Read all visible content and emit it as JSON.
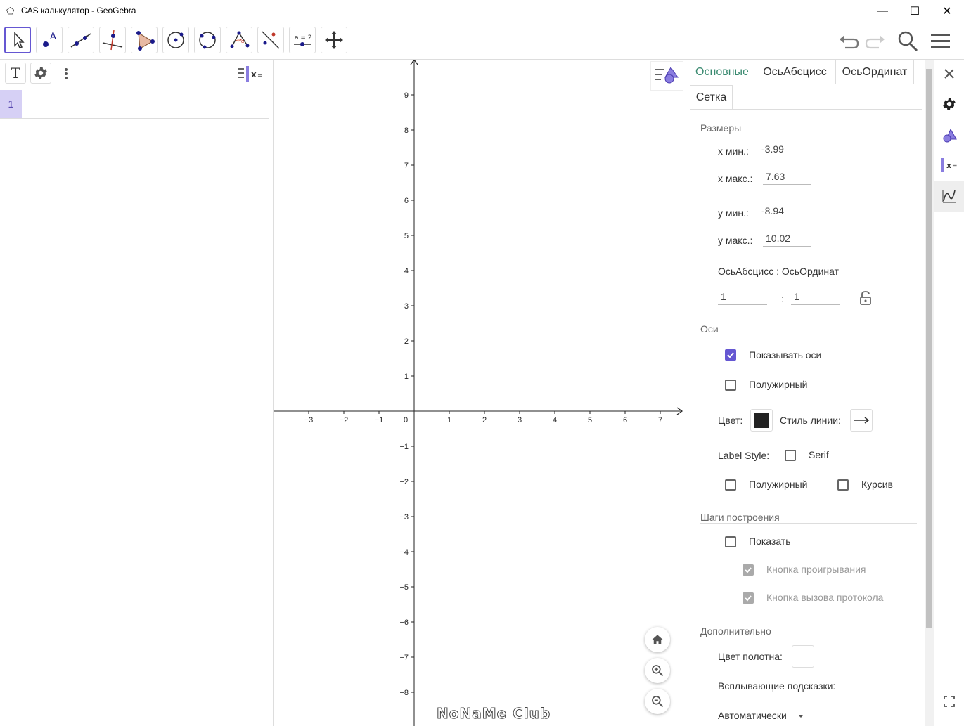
{
  "window": {
    "title": "CAS калькулятор - GeoGebra",
    "minimize": "—",
    "maximize": "☐",
    "close": "✕"
  },
  "toolbar": {
    "tools": [
      "move-tool",
      "point-tool",
      "line-tool",
      "perpendicular-line-tool",
      "polygon-tool",
      "circle-center-point-tool",
      "circle-three-points-tool",
      "angle-tool",
      "reflect-tool",
      "slider-tool",
      "move-graphics-tool"
    ],
    "slider_label": "a = 2"
  },
  "algebra": {
    "text_button": "T",
    "row_number": "1"
  },
  "graphics": {
    "x_ticks": [
      "−3",
      "−2",
      "−1",
      "0",
      "1",
      "2",
      "3",
      "4",
      "5",
      "6",
      "7"
    ],
    "y_ticks_pos": [
      "9",
      "8",
      "7",
      "6",
      "5",
      "4",
      "3",
      "2",
      "1"
    ],
    "y_ticks_neg": [
      "−1",
      "−2",
      "−3",
      "−4",
      "−5",
      "−6",
      "−7",
      "−8"
    ],
    "watermark": "NoNaMe Club"
  },
  "properties": {
    "tabs": [
      "Основные",
      "ОсьАбсцисс",
      "ОсьОрдинат",
      "Сетка"
    ],
    "dimensions": {
      "title": "Размеры",
      "xmin_label": "x мин.:",
      "xmin": "-3.99",
      "xmax_label": "x макс.:",
      "xmax": "7.63",
      "ymin_label": "y мин.:",
      "ymin": "-8.94",
      "ymax_label": "y макс.:",
      "ymax": "10.02",
      "ratio_label": "ОсьАбсцисс : ОсьОрдинат",
      "ratio_x": "1",
      "ratio_sep": ":",
      "ratio_y": "1"
    },
    "axes": {
      "title": "Оси",
      "show_axes": "Показывать оси",
      "bold": "Полужирный",
      "color_label": "Цвет:",
      "color": "#222222",
      "line_style_label": "Стиль линии:",
      "label_style": "Label Style:",
      "serif": "Serif",
      "bold2": "Полужирный",
      "italic": "Курсив"
    },
    "construction": {
      "title": "Шаги построения",
      "show": "Показать",
      "play_button": "Кнопка проигрывания",
      "protocol_button": "Кнопка вызова протокола"
    },
    "advanced": {
      "title": "Дополнительно",
      "bg_color_label": "Цвет полотна:",
      "tooltips_label": "Всплывающие подсказки:",
      "tooltips_value": "Автоматически"
    }
  },
  "colors": {
    "accent": "#6557d2",
    "tab_active": "#3a8a70"
  }
}
